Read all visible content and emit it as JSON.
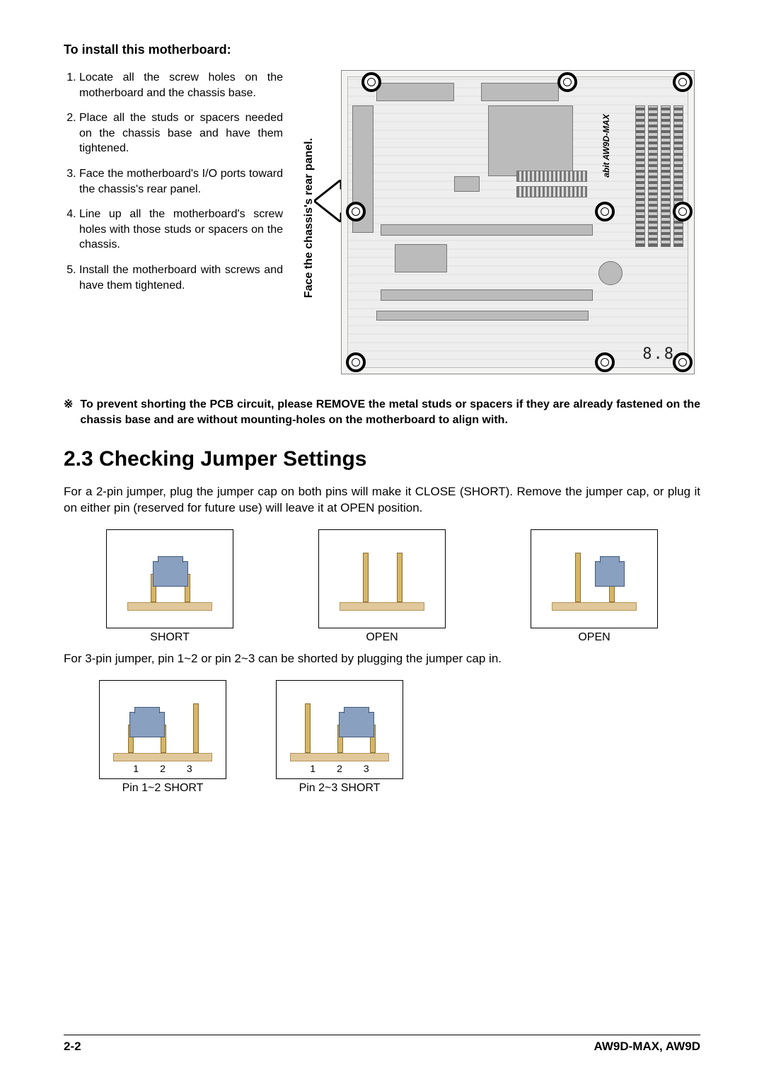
{
  "sections": {
    "install_heading": "To install this motherboard:",
    "install_steps": [
      "Locate all the screw holes on the motherboard and the chassis base.",
      "Place all the studs or spacers needed on the chassis base and have them tightened.",
      "Face the motherboard's I/O ports toward the chassis's rear panel.",
      "Line up all the motherboard's screw holes with those studs or spacers on the chassis.",
      "Install the motherboard with screws and have them tightened."
    ],
    "face_label": "Face the chassis's rear panel.",
    "board_brand": "abit AW9D-MAX",
    "board_display": "8.8",
    "note_symbol": "※",
    "note_text": "To prevent shorting the PCB circuit, please REMOVE the metal studs or spacers if they are already fastened on the chassis base and are without mounting-holes on the motherboard to align with.",
    "jumper_heading": "2.3 Checking Jumper Settings",
    "jumper_para1": "For a 2-pin jumper, plug the jumper cap on both pins will make it CLOSE (SHORT). Remove the jumper cap, or plug it on either pin (reserved for future use) will leave it at OPEN position.",
    "jumper_labels": {
      "short": "SHORT",
      "open1": "OPEN",
      "open2": "OPEN"
    },
    "jumper_para2": "For 3-pin jumper, pin 1~2 or pin 2~3 can be shorted by plugging the jumper cap in.",
    "pin_numbers": [
      "1",
      "2",
      "3"
    ],
    "jumper3_labels": {
      "a": "Pin 1~2 SHORT",
      "b": "Pin 2~3 SHORT"
    }
  },
  "footer": {
    "page": "2-2",
    "model": "AW9D-MAX, AW9D"
  }
}
